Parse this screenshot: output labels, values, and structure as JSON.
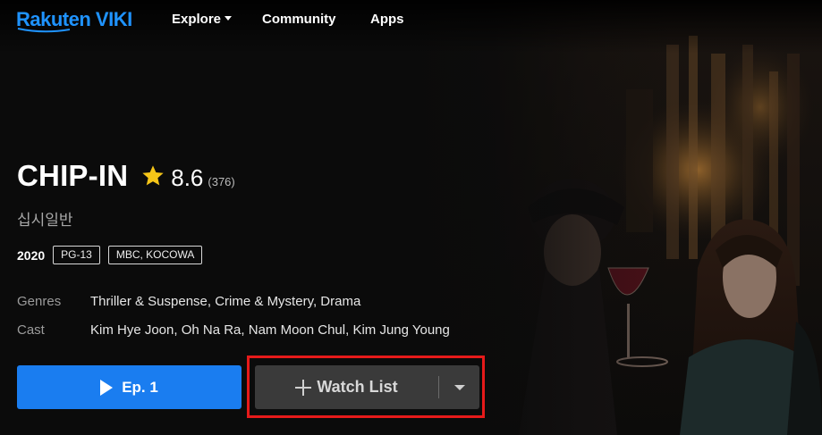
{
  "nav": {
    "logo_text": "Rakuten VIKI",
    "explore_label": "Explore",
    "community_label": "Community",
    "apps_label": "Apps"
  },
  "show": {
    "title": "CHIP-IN",
    "rating": "8.6",
    "rating_count": "(376)",
    "native_title": "십시일반",
    "year": "2020",
    "content_rating": "PG-13",
    "networks": "MBC, KOCOWA",
    "genres_label": "Genres",
    "genres_value": "Thriller & Suspense, Crime & Mystery, Drama",
    "cast_label": "Cast",
    "cast_value": "Kim Hye Joon, Oh Na Ra, Nam Moon Chul, Kim Jung Young"
  },
  "actions": {
    "play_label": "Ep. 1",
    "watchlist_label": "Watch List"
  },
  "colors": {
    "brand_blue": "#1f93ff",
    "play_button": "#1a7df0",
    "watchlist_button": "#3a3a3a",
    "highlight": "#e61a1a",
    "star": "#f5c518"
  },
  "icons": {
    "rating": "star-icon",
    "play": "play-icon",
    "watchlist_add": "plus-icon",
    "watchlist_menu": "chevron-down-icon",
    "explore_menu": "caret-down-icon"
  }
}
